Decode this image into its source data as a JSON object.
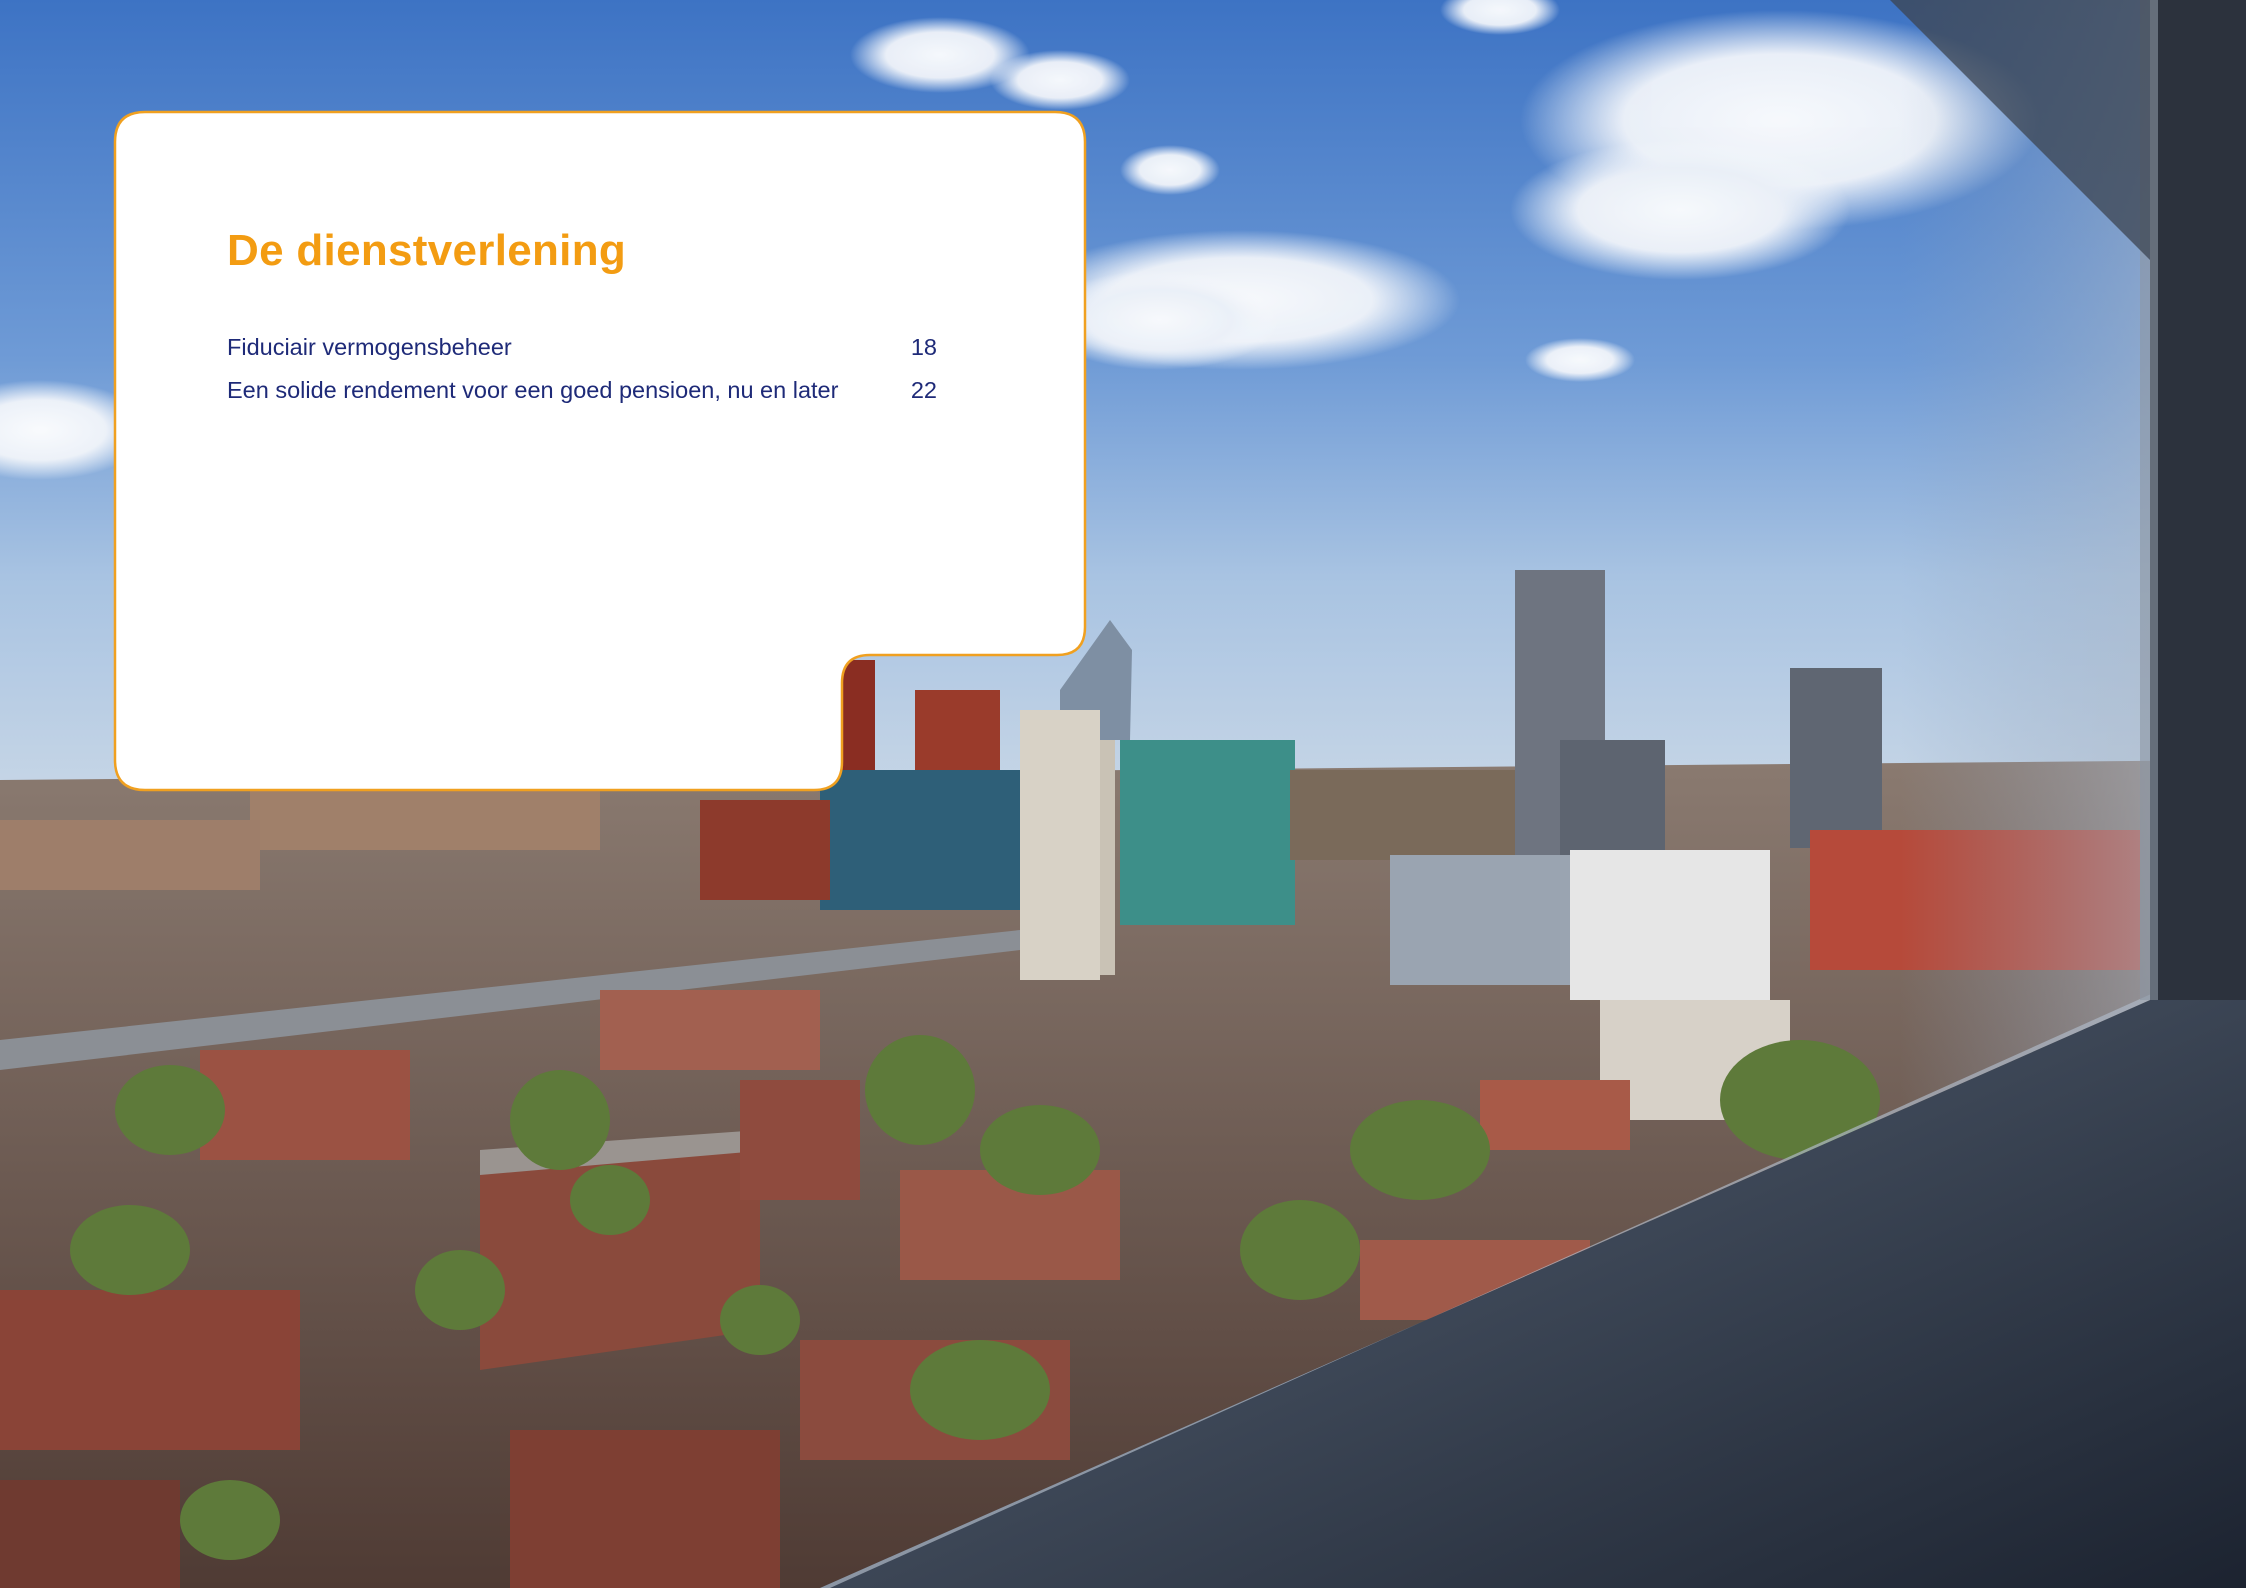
{
  "section": {
    "title": "De dienstverlening",
    "entries": [
      {
        "label": "Fiduciair vermogensbeheer",
        "page": "18"
      },
      {
        "label": "Een solide rendement voor een goed pensioen, nu en later",
        "page": "22"
      }
    ]
  },
  "colors": {
    "title": "#f39c12",
    "entry_text": "#1e2a78",
    "card_fill": "#ffffff",
    "card_border": "#f0a020"
  },
  "background_photo": "aerial-city-skyline-the-hague-through-window"
}
